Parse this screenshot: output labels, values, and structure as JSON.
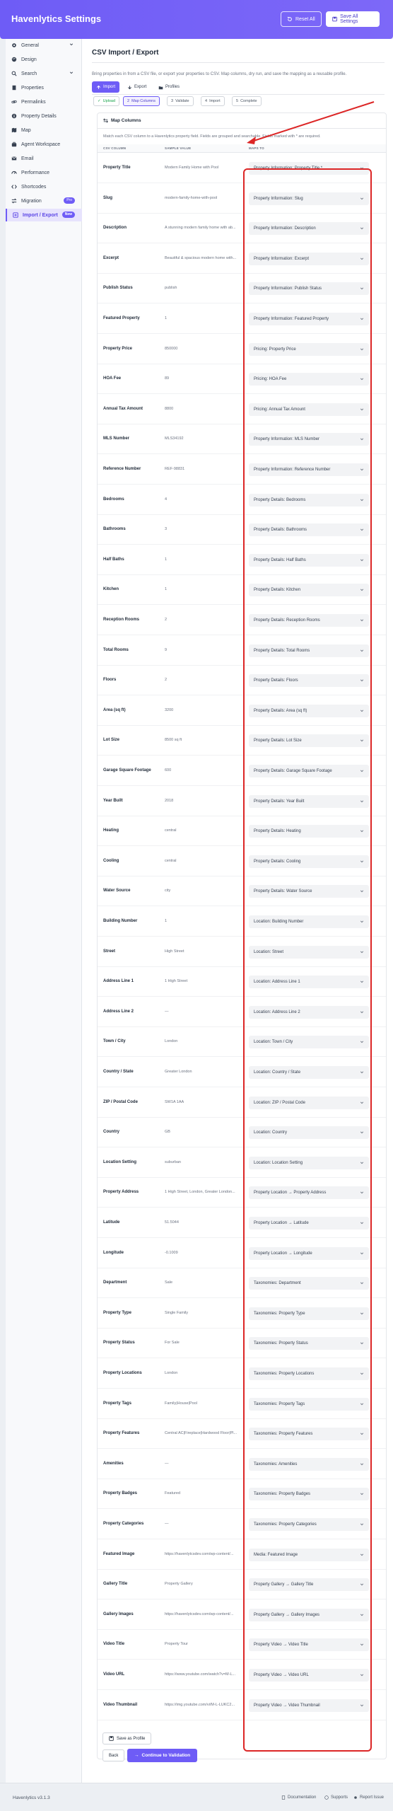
{
  "header": {
    "title": "Havenlytics Settings",
    "reset_label": "Reset All",
    "save_all_label": "Save All Settings"
  },
  "sidebar": {
    "items": [
      {
        "label": "General",
        "icon": "gear-icon",
        "has_chevron": true
      },
      {
        "label": "Design",
        "icon": "palette-icon"
      },
      {
        "label": "Search",
        "icon": "search-icon",
        "has_chevron": true
      },
      {
        "label": "Properties",
        "icon": "building-icon"
      },
      {
        "label": "Permalinks",
        "icon": "link-icon"
      },
      {
        "label": "Property Details",
        "icon": "info-icon"
      },
      {
        "label": "Map",
        "icon": "map-icon"
      },
      {
        "label": "Agent Workspace",
        "icon": "briefcase-icon"
      },
      {
        "label": "Email",
        "icon": "mail-icon"
      },
      {
        "label": "Performance",
        "icon": "gauge-icon"
      },
      {
        "label": "Shortcodes",
        "icon": "code-icon"
      },
      {
        "label": "Migration",
        "icon": "migrate-icon",
        "badge": "Pro"
      },
      {
        "label": "Import / Export",
        "icon": "import-export-icon",
        "badge": "New",
        "active": true
      }
    ]
  },
  "main": {
    "title": "CSV Import / Export",
    "intro": "Bring properties in from a CSV file, or export your properties to CSV. Map columns, dry run, and save the mapping as a reusable profile.",
    "tabs": [
      {
        "label": "Import",
        "active": true
      },
      {
        "label": "Export"
      },
      {
        "label": "Profiles"
      }
    ],
    "steps": [
      {
        "label": "Upload",
        "state": "done"
      },
      {
        "label": "Map Columns",
        "state": "current"
      },
      {
        "label": "Validate",
        "state": "todo"
      },
      {
        "label": "Import",
        "state": "todo"
      },
      {
        "label": "Complete",
        "state": "todo"
      }
    ],
    "card_title": "Map Columns",
    "card_desc": "Match each CSV column to a Havenlytics property field. Fields are grouped and searchable. Fields marked with * are required.",
    "columns": {
      "csv": "CSV COLUMN",
      "sample": "SAMPLE VALUE",
      "maps": "MAPS TO"
    },
    "rows": [
      {
        "col": "Property Title",
        "sample": "Modern Family Home with Pool",
        "maps": "Property Information: Property Title *"
      },
      {
        "col": "Slug",
        "sample": "modern-family-home-with-pool",
        "maps": "Property Information: Slug"
      },
      {
        "col": "Description",
        "sample": "A stunning modern family home with ab...",
        "maps": "Property Information: Description"
      },
      {
        "col": "Excerpt",
        "sample": "Beautiful & spacious modern home with...",
        "maps": "Property Information: Excerpt"
      },
      {
        "col": "Publish Status",
        "sample": "publish",
        "maps": "Property Information: Publish Status"
      },
      {
        "col": "Featured Property",
        "sample": "1",
        "maps": "Property Information: Featured Property"
      },
      {
        "col": "Property Price",
        "sample": "850000",
        "maps": "Pricing: Property Price"
      },
      {
        "col": "HOA Fee",
        "sample": "89",
        "maps": "Pricing: HOA Fee"
      },
      {
        "col": "Annual Tax Amount",
        "sample": "8800",
        "maps": "Pricing: Annual Tax Amount"
      },
      {
        "col": "MLS Number",
        "sample": "MLS34192",
        "maps": "Property Information: MLS Number"
      },
      {
        "col": "Reference Number",
        "sample": "REF-98831",
        "maps": "Property Information: Reference Number"
      },
      {
        "col": "Bedrooms",
        "sample": "4",
        "maps": "Property Details: Bedrooms"
      },
      {
        "col": "Bathrooms",
        "sample": "3",
        "maps": "Property Details: Bathrooms"
      },
      {
        "col": "Half Baths",
        "sample": "1",
        "maps": "Property Details: Half Baths"
      },
      {
        "col": "Kitchen",
        "sample": "1",
        "maps": "Property Details: Kitchen"
      },
      {
        "col": "Reception Rooms",
        "sample": "2",
        "maps": "Property Details: Reception Rooms"
      },
      {
        "col": "Total Rooms",
        "sample": "9",
        "maps": "Property Details: Total Rooms"
      },
      {
        "col": "Floors",
        "sample": "2",
        "maps": "Property Details: Floors"
      },
      {
        "col": "Area (sq ft)",
        "sample": "3200",
        "maps": "Property Details: Area (sq ft)"
      },
      {
        "col": "Lot Size",
        "sample": "8500 sq ft",
        "maps": "Property Details: Lot Size"
      },
      {
        "col": "Garage Square Footage",
        "sample": "600",
        "maps": "Property Details: Garage Square Footage"
      },
      {
        "col": "Year Built",
        "sample": "2018",
        "maps": "Property Details: Year Built"
      },
      {
        "col": "Heating",
        "sample": "central",
        "maps": "Property Details: Heating"
      },
      {
        "col": "Cooling",
        "sample": "central",
        "maps": "Property Details: Cooling"
      },
      {
        "col": "Water Source",
        "sample": "city",
        "maps": "Property Details: Water Source"
      },
      {
        "col": "Building Number",
        "sample": "1",
        "maps": "Location: Building Number"
      },
      {
        "col": "Street",
        "sample": "High Street",
        "maps": "Location: Street"
      },
      {
        "col": "Address Line 1",
        "sample": "1 High Street",
        "maps": "Location: Address Line 1"
      },
      {
        "col": "Address Line 2",
        "sample": "—",
        "maps": "Location: Address Line 2"
      },
      {
        "col": "Town / City",
        "sample": "London",
        "maps": "Location: Town / City"
      },
      {
        "col": "Country / State",
        "sample": "Greater London",
        "maps": "Location: Country / State"
      },
      {
        "col": "ZIP / Postal Code",
        "sample": "SW1A 1AA",
        "maps": "Location: ZIP / Postal Code"
      },
      {
        "col": "Country",
        "sample": "GB",
        "maps": "Location: Country"
      },
      {
        "col": "Location Setting",
        "sample": "suburban",
        "maps": "Location: Location Setting"
      },
      {
        "col": "Property Address",
        "sample": "1 High Street, London, Greater London...",
        "maps": "Property Location → Property Address"
      },
      {
        "col": "Latitude",
        "sample": "51.5044",
        "maps": "Property Location → Latitude"
      },
      {
        "col": "Longitude",
        "sample": "-0.1009",
        "maps": "Property Location → Longitude"
      },
      {
        "col": "Department",
        "sample": "Sale",
        "maps": "Taxonomies: Department"
      },
      {
        "col": "Property Type",
        "sample": "Single Family",
        "maps": "Taxonomies: Property Type"
      },
      {
        "col": "Property Status",
        "sample": "For Sale",
        "maps": "Taxonomies: Property Status"
      },
      {
        "col": "Property Locations",
        "sample": "London",
        "maps": "Taxonomies: Property Locations"
      },
      {
        "col": "Property Tags",
        "sample": "Family|House|Pool",
        "maps": "Taxonomies: Property Tags"
      },
      {
        "col": "Property Features",
        "sample": "Central AC|Fireplace|Hardwood Floor|Pl...",
        "maps": "Taxonomies: Property Features"
      },
      {
        "col": "Amenities",
        "sample": "—",
        "maps": "Taxonomies: Amenities"
      },
      {
        "col": "Property Badges",
        "sample": "Featured",
        "maps": "Taxonomies: Property Badges"
      },
      {
        "col": "Property Categories",
        "sample": "—",
        "maps": "Taxonomies: Property Categories"
      },
      {
        "col": "Featured Image",
        "sample": "https://havenlytcsdev.com/wp-content/...",
        "maps": "Media: Featured Image"
      },
      {
        "col": "Gallery Title",
        "sample": "Property Gallery",
        "maps": "Property Gallery → Gallery Title"
      },
      {
        "col": "Gallery Images",
        "sample": "https://havenlytcsdev.com/wp-content/...",
        "maps": "Property Gallery → Gallery Images"
      },
      {
        "col": "Video Title",
        "sample": "Property Tour",
        "maps": "Property Video → Video Title"
      },
      {
        "col": "Video URL",
        "sample": "https://www.youtube.com/watch?v=M-L...",
        "maps": "Property Video → Video URL"
      },
      {
        "col": "Video Thumbnail",
        "sample": "https://img.youtube.com/vi/M-L-LUKC2...",
        "maps": "Property Video → Video Thumbnail"
      }
    ],
    "save_profile_label": "Save as Profile",
    "back_label": "Back",
    "continue_label": "Continue to Validation"
  },
  "footer": {
    "version": "Havenlytics v3.1.3",
    "links": [
      "Documentation",
      "Supports",
      "Report Issue"
    ]
  },
  "colors": {
    "accent": "#6e5cf6",
    "highlight": "#dc2626"
  }
}
